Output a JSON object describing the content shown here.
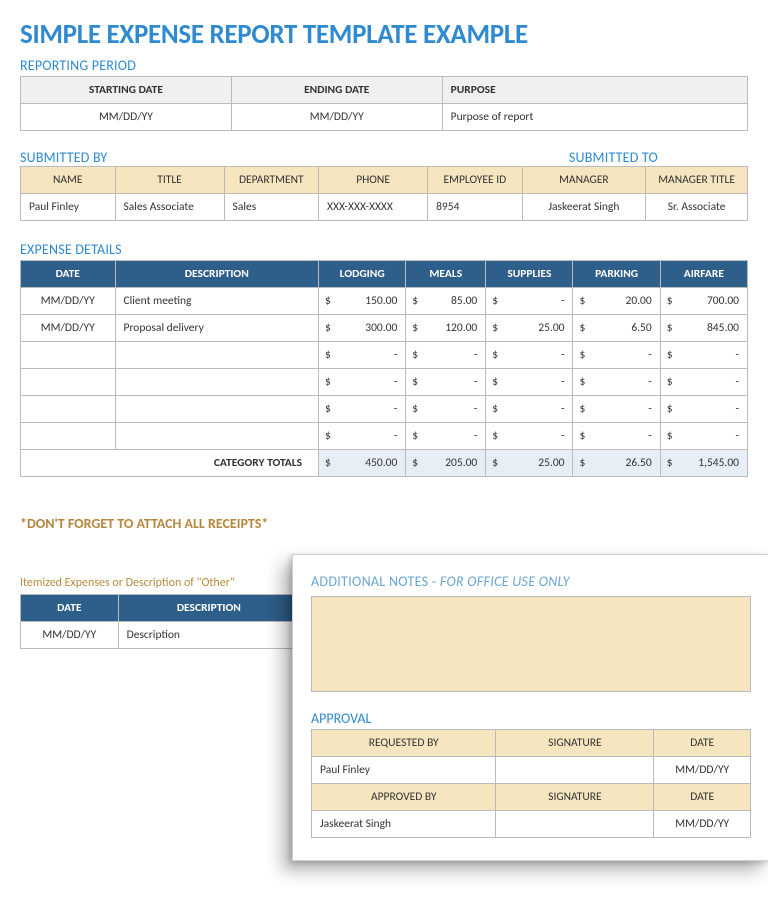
{
  "title": "SIMPLE EXPENSE REPORT TEMPLATE EXAMPLE",
  "reporting": {
    "section": "REPORTING PERIOD",
    "headers": {
      "start": "STARTING DATE",
      "end": "ENDING DATE",
      "purpose": "PURPOSE"
    },
    "values": {
      "start": "MM/DD/YY",
      "end": "MM/DD/YY",
      "purpose": "Purpose of report"
    }
  },
  "submitted": {
    "by_label": "SUBMITTED BY",
    "to_label": "SUBMITTED TO",
    "headers": {
      "name": "NAME",
      "title": "TITLE",
      "department": "DEPARTMENT",
      "phone": "PHONE",
      "emp_id": "EMPLOYEE ID",
      "manager": "MANAGER",
      "manager_title": "MANAGER TITLE"
    },
    "values": {
      "name": "Paul Finley",
      "title": "Sales Associate",
      "department": "Sales",
      "phone": "XXX-XXX-XXXX",
      "emp_id": "8954",
      "manager": "Jaskeerat Singh",
      "manager_title": "Sr. Associate"
    }
  },
  "expense": {
    "section": "EXPENSE DETAILS",
    "headers": {
      "date": "DATE",
      "description": "DESCRIPTION",
      "lodging": "LODGING",
      "meals": "MEALS",
      "supplies": "SUPPLIES",
      "parking": "PARKING",
      "airfare": "AIRFARE"
    },
    "rows": [
      {
        "date": "MM/DD/YY",
        "description": "Client meeting",
        "lodging": "150.00",
        "meals": "85.00",
        "supplies": "-",
        "parking": "20.00",
        "airfare": "700.00"
      },
      {
        "date": "MM/DD/YY",
        "description": "Proposal delivery",
        "lodging": "300.00",
        "meals": "120.00",
        "supplies": "25.00",
        "parking": "6.50",
        "airfare": "845.00"
      },
      {
        "date": "",
        "description": "",
        "lodging": "-",
        "meals": "-",
        "supplies": "-",
        "parking": "-",
        "airfare": "-"
      },
      {
        "date": "",
        "description": "",
        "lodging": "-",
        "meals": "-",
        "supplies": "-",
        "parking": "-",
        "airfare": "-"
      },
      {
        "date": "",
        "description": "",
        "lodging": "-",
        "meals": "-",
        "supplies": "-",
        "parking": "-",
        "airfare": "-"
      },
      {
        "date": "",
        "description": "",
        "lodging": "-",
        "meals": "-",
        "supplies": "-",
        "parking": "-",
        "airfare": "-"
      }
    ],
    "totals_label": "CATEGORY TOTALS",
    "totals": {
      "lodging": "450.00",
      "meals": "205.00",
      "supplies": "25.00",
      "parking": "26.50",
      "airfare": "1,545.00"
    }
  },
  "receipts_note": "*DON'T FORGET TO ATTACH ALL RECEIPTS*",
  "itemized": {
    "note": "Itemized Expenses or Description of \"Other\"",
    "headers": {
      "date": "DATE",
      "description": "DESCRIPTION"
    },
    "row": {
      "date": "MM/DD/YY",
      "description": "Description"
    }
  },
  "notes": {
    "prefix": "ADDITIONAL NOTES - ",
    "suffix": "FOR OFFICE USE ONLY"
  },
  "approval": {
    "section": "APPROVAL",
    "headers": {
      "requested": "REQUESTED BY",
      "approved": "APPROVED BY",
      "signature": "SIGNATURE",
      "date": "DATE"
    },
    "requested_by": "Paul Finley",
    "approved_by": "Jaskeerat Singh",
    "date_value": "MM/DD/YY"
  }
}
